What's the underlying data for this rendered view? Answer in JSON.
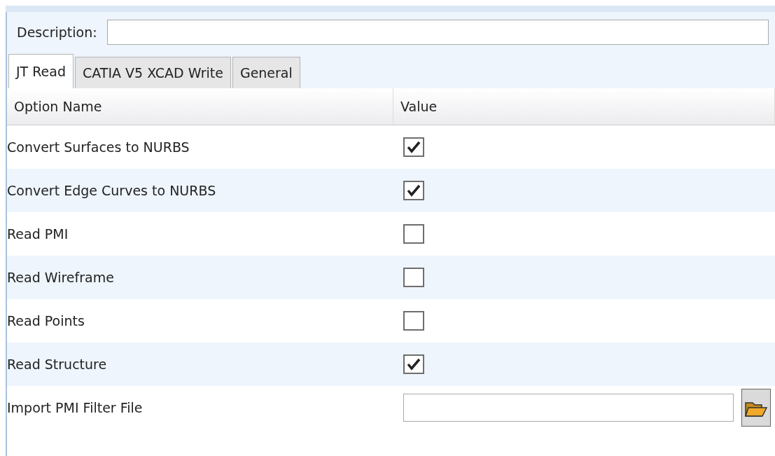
{
  "description": {
    "label": "Description:"
  },
  "tabs": [
    {
      "label": "JT Read",
      "selected": true
    },
    {
      "label": "CATIA V5 XCAD Write",
      "selected": false
    },
    {
      "label": "General",
      "selected": false
    }
  ],
  "table": {
    "columns": [
      "Option Name",
      "Value"
    ],
    "rows": [
      {
        "name": "Convert Surfaces to NURBS",
        "kind": "checkbox",
        "checked": true
      },
      {
        "name": "Convert Edge Curves to NURBS",
        "kind": "checkbox",
        "checked": true
      },
      {
        "name": "Read PMI",
        "kind": "checkbox",
        "checked": false
      },
      {
        "name": "Read Wireframe",
        "kind": "checkbox",
        "checked": false
      },
      {
        "name": "Read Points",
        "kind": "checkbox",
        "checked": false
      },
      {
        "name": "Read Structure",
        "kind": "checkbox",
        "checked": true
      },
      {
        "name": "Import PMI Filter File",
        "kind": "file"
      }
    ]
  }
}
